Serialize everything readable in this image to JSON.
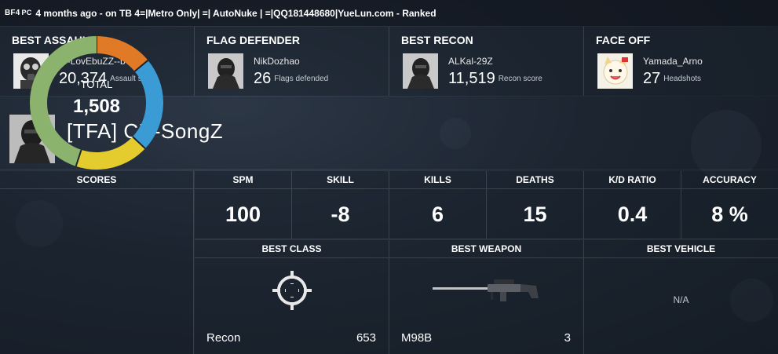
{
  "header": {
    "game_badge": "BF4",
    "platform_badge": "PC",
    "info": "4 months ago - on TB 4=|Metro Only| =| AutoNuke | =|QQ181448680|YueLun.com - Ranked"
  },
  "awards": [
    {
      "title": "BEST ASSAULT",
      "player": "d--LovEbuZZ--b",
      "value": "20,374",
      "unit": "Assault score",
      "avatar_icon": "gas-mask-soldier-icon"
    },
    {
      "title": "FLAG DEFENDER",
      "player": "NikDozhao",
      "value": "26",
      "unit": "Flags defended",
      "avatar_icon": "soldier-silhouette-icon"
    },
    {
      "title": "BEST RECON",
      "player": "ALKal-29Z",
      "value": "11,519",
      "unit": "Recon score",
      "avatar_icon": "soldier-silhouette-icon"
    },
    {
      "title": "FACE OFF",
      "player": "Yamada_Arno",
      "value": "27",
      "unit": "Headshots",
      "avatar_icon": "cartoon-cat-icon"
    }
  ],
  "player": {
    "name": "[TFA] CN-SongZ",
    "avatar_icon": "soldier-silhouette-icon"
  },
  "scores": {
    "label": "SCORES",
    "total_label": "TOTAL",
    "total_value": "1,508",
    "segments": [
      {
        "color": "#e07a26",
        "fraction": 0.14
      },
      {
        "color": "#3b9bd4",
        "fraction": 0.23
      },
      {
        "color": "#e4cb2e",
        "fraction": 0.18
      },
      {
        "color": "#8bb36d",
        "fraction": 0.45
      }
    ]
  },
  "stats": [
    {
      "label": "SPM",
      "value": "100"
    },
    {
      "label": "SKILL",
      "value": "-8"
    },
    {
      "label": "KILLS",
      "value": "6"
    },
    {
      "label": "DEATHS",
      "value": "15"
    },
    {
      "label": "K/D RATIO",
      "value": "0.4"
    },
    {
      "label": "ACCURACY",
      "value": "8 %"
    }
  ],
  "best": {
    "class": {
      "label": "BEST CLASS",
      "name": "Recon",
      "count": "653",
      "icon": "recon-crosshair-icon"
    },
    "weapon": {
      "label": "BEST WEAPON",
      "name": "M98B",
      "count": "3",
      "icon": "sniper-rifle-icon"
    },
    "vehicle": {
      "label": "BEST VEHICLE",
      "empty_text": "N/A"
    }
  }
}
